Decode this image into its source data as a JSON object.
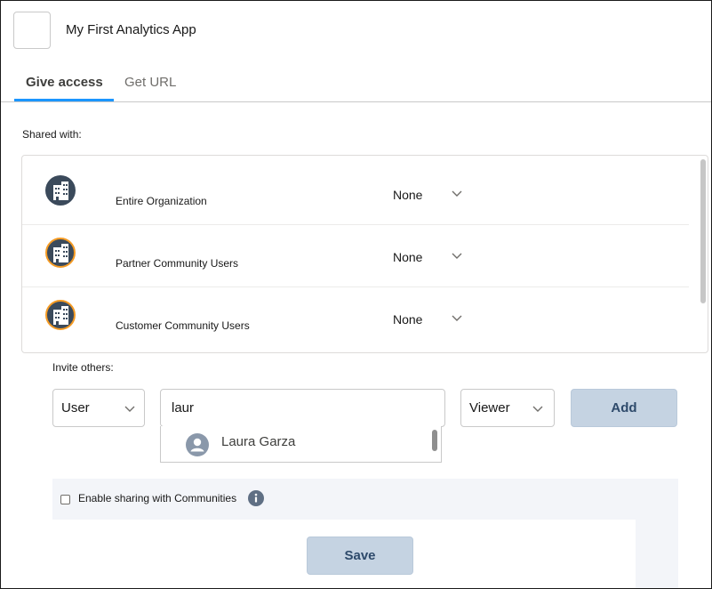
{
  "app": {
    "title": "My First Analytics App",
    "icon": "app-icon-placeholder"
  },
  "tabs": [
    {
      "label": "Give access",
      "active": true
    },
    {
      "label": "Get URL",
      "active": false
    }
  ],
  "shared_with": {
    "label": "Shared with:",
    "rows": [
      {
        "name": "Entire Organization",
        "access": "None",
        "icon": "building-icon",
        "ring_color": "#3b4a5b"
      },
      {
        "name": "Partner Community Users",
        "access": "None",
        "icon": "building-icon",
        "ring_color": "#f59b24"
      },
      {
        "name": "Customer Community Users",
        "access": "None",
        "icon": "building-icon",
        "ring_color": "#f59b24"
      }
    ]
  },
  "invite": {
    "label": "Invite others:",
    "type_value": "User",
    "search_value": "laur",
    "role_value": "Viewer",
    "add_label": "Add",
    "suggestions": [
      {
        "name": "Laura Garza",
        "icon": "user-avatar-icon"
      }
    ]
  },
  "communities": {
    "checkbox_label": "Enable sharing with Communities",
    "checked": false
  },
  "save_label": "Save",
  "colors": {
    "tab_accent": "#1b96ff",
    "icon_dark": "#3b4a5b",
    "community_ring": "#f59b24",
    "button_bg": "#c5d3e2",
    "button_text": "#2e4a6b",
    "panel_bg": "#f3f5f9"
  }
}
